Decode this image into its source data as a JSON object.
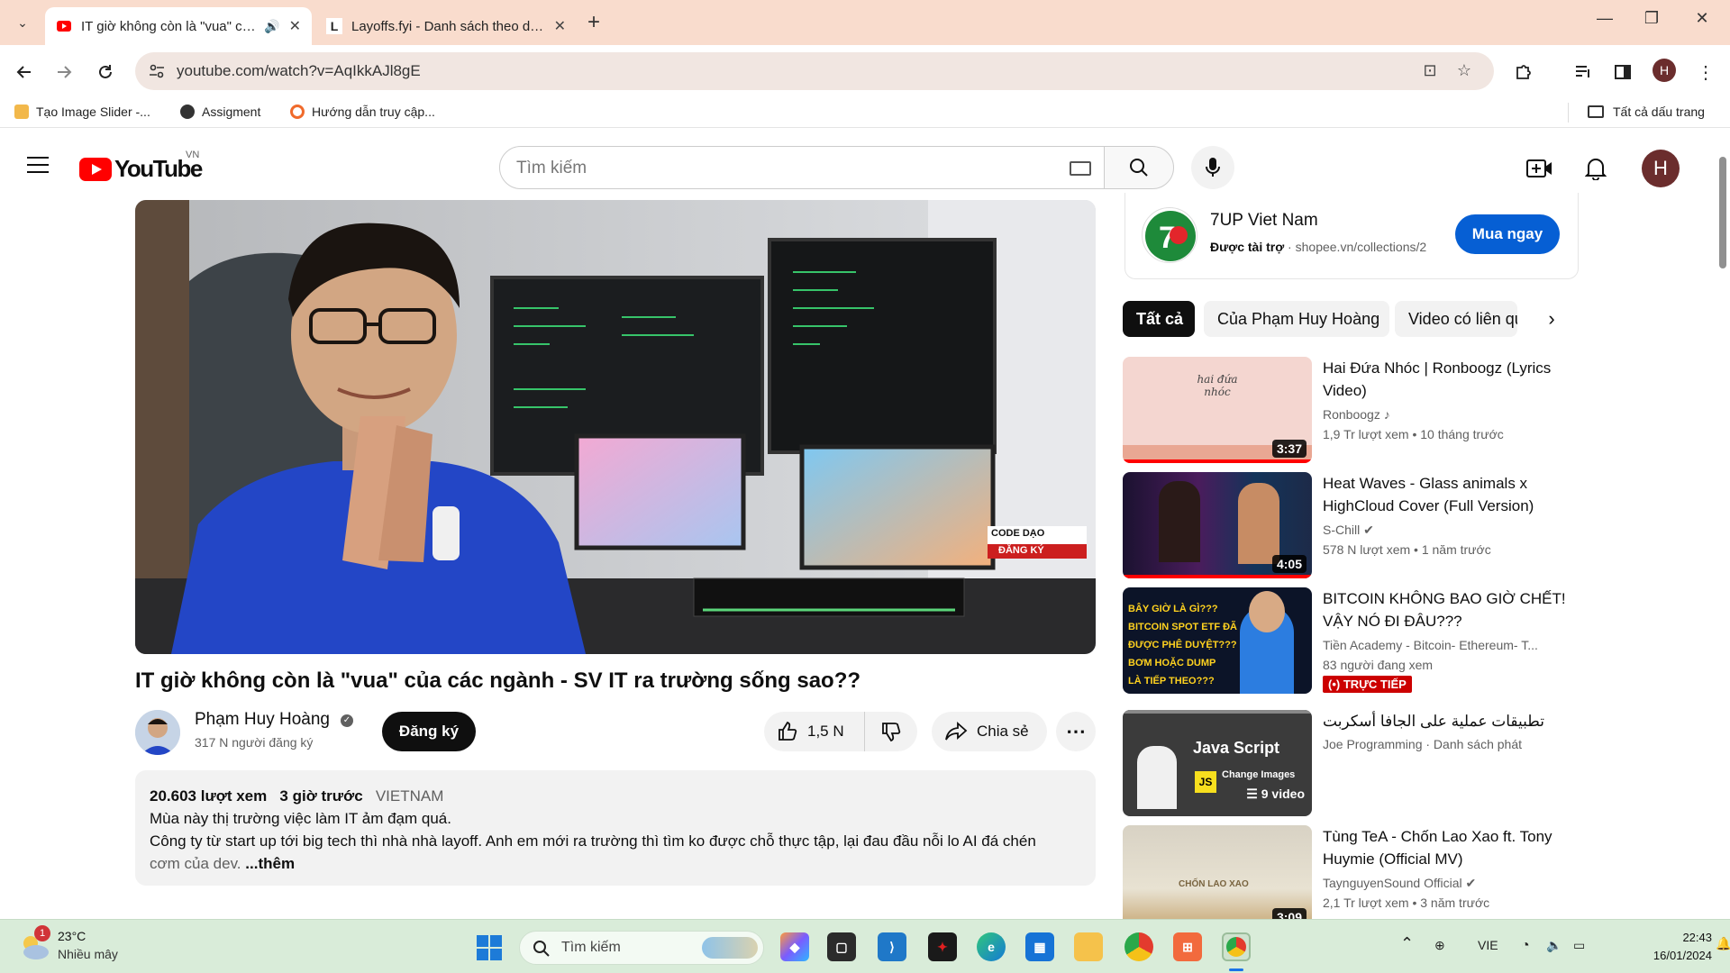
{
  "browser": {
    "tabs": [
      {
        "title": "IT giờ không còn là \"vua\" của các ngành - SV IT ra trường sống sao?? - YouTube",
        "active": true
      },
      {
        "title": "Layoffs.fyi - Danh sách theo dõi sa thải",
        "active": false
      }
    ],
    "url": "youtube.com/watch?v=AqIkkAJl8gE",
    "bookmarks": [
      "Tạo Image Slider -...",
      "Assigment",
      "Hướng dẫn truy cập..."
    ],
    "all_bookmarks": "Tất cả dấu trang",
    "profile_letter": "H"
  },
  "youtube": {
    "logo_text": "YouTube",
    "country": "VN",
    "search_placeholder": "Tìm kiếm",
    "avatar_letter": "H"
  },
  "video": {
    "title": "IT giờ không còn là \"vua\" của các ngành - SV IT ra trường sống sao??",
    "channel": "Phạm Huy Hoàng",
    "subscribers": "317 N người đăng ký",
    "subscribe_label": "Đăng ký",
    "likes": "1,5 N",
    "share_label": "Chia sẻ",
    "views": "20.603 lượt xem",
    "posted": "3 giờ trước",
    "tag": "VIETNAM",
    "desc_line1": "Mùa này thị trường việc làm IT ảm đạm quá.",
    "desc_line2": "Công ty từ start up tới big tech thì nhà nhà layoff. Anh em mới ra trường thì tìm ko được chỗ thực tập, lại đau đầu nỗi lo AI đá chén",
    "desc_line3": "cơm của dev.",
    "more_label": "...thêm",
    "overlay_text": "CODE DẠO",
    "overlay_sub": "ĐĂNG KÝ"
  },
  "ad": {
    "title": "7UP Viet Nam",
    "sponsored": "Được tài trợ",
    "domain": "shopee.vn/collections/2",
    "cta": "Mua ngay",
    "logo_text": "7up"
  },
  "chips": [
    "Tất cả",
    "Của Phạm Huy Hoàng",
    "Video có liên quan"
  ],
  "recommendations": [
    {
      "title": "Hai Đứa Nhóc | Ronboogz (Lyrics Video)",
      "channel": "Ronboogz ♪",
      "meta": "1,9 Tr lượt xem  •  10 tháng trước",
      "duration": "3:37",
      "thumb_text": "hai đứa nhóc",
      "progress": 1.0
    },
    {
      "title": "Heat Waves - Glass animals x HighCloud Cover (Full Version)",
      "channel": "S-Chill ✔",
      "meta": "578 N lượt xem  •  1 năm trước",
      "duration": "4:05",
      "progress": 1.0
    },
    {
      "title": "BITCOIN KHÔNG BAO GIỜ CHẾT! VẬY NÓ ĐI ĐÂU???",
      "channel": "Tiền Academy - Bitcoin- Ethereum- T...",
      "meta": "83 người đang xem",
      "live": "(•) TRỰC TIẾP",
      "thumb_lines": [
        "BÂY GIỜ LÀ GÌ???",
        "BITCOIN SPOT ETF ĐÃ",
        "ĐƯỢC PHÊ DUYỆT???",
        "BƠM HOẶC DUMP",
        "LÀ TIẾP THEO???"
      ]
    },
    {
      "title": "تطبيقات عملية على الجافا أسكربت",
      "channel": "Joe Programming · Danh sách phát",
      "playlist": "9 video",
      "thumb_text": "Java Script",
      "thumb_sub": "Change Images"
    },
    {
      "title": "Tùng TeA - Chốn Lao Xao ft. Tony Huymie (Official MV)",
      "channel": "TaynguyenSound Official ✔",
      "meta": "2,1 Tr lượt xem  •  3 năm trước",
      "duration": "3:09",
      "thumb_text": "CHỐN LAO XAO"
    }
  ],
  "taskbar": {
    "temperature": "23°C",
    "weather": "Nhiều mây",
    "weather_badge": "1",
    "search_placeholder": "Tìm kiếm",
    "language": "VIE",
    "time": "22:43",
    "date": "16/01/2024"
  }
}
